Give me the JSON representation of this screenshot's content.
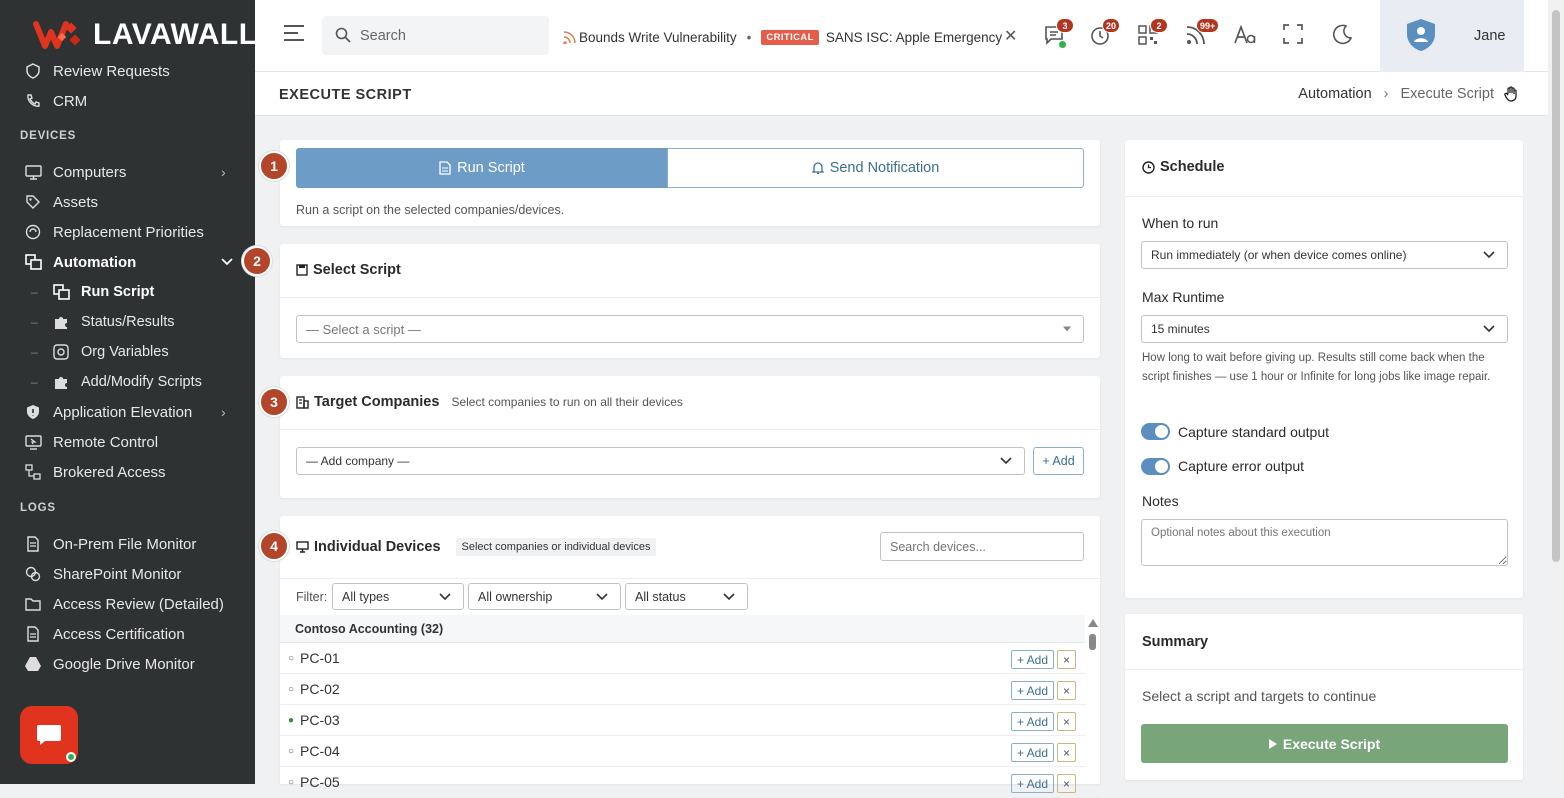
{
  "brand": {
    "name": "LAVAWALL",
    "mark": "®"
  },
  "sidebar": {
    "items": [
      {
        "label": "Review Requests"
      },
      {
        "label": "CRM"
      }
    ],
    "devices_heading": "DEVICES",
    "devices": [
      {
        "label": "Computers"
      },
      {
        "label": "Assets"
      },
      {
        "label": "Replacement Priorities"
      },
      {
        "label": "Automation"
      },
      {
        "label": "Run Script"
      },
      {
        "label": "Status/Results"
      },
      {
        "label": "Org Variables"
      },
      {
        "label": "Add/Modify Scripts"
      },
      {
        "label": "Application Elevation"
      },
      {
        "label": "Remote Control"
      },
      {
        "label": "Brokered Access"
      }
    ],
    "logs_heading": "LOGS",
    "logs": [
      {
        "label": "On-Prem File Monitor"
      },
      {
        "label": "SharePoint Monitor"
      },
      {
        "label": "Access Review (Detailed)"
      },
      {
        "label": "Access Certification"
      },
      {
        "label": "Google Drive Monitor"
      }
    ]
  },
  "topbar": {
    "search_placeholder": "Search",
    "ticker": {
      "item1": "Bounds Write Vulnerability",
      "critical_badge": "CRITICAL",
      "item2": "SANS ISC: Apple Emergency"
    },
    "badges": {
      "messages": "3",
      "alerts": "20",
      "qr": "2",
      "feed": "99+"
    },
    "user_name": "Jane"
  },
  "page": {
    "title": "EXECUTE SCRIPT",
    "breadcrumb": [
      "Automation",
      "Execute Script"
    ]
  },
  "step1": {
    "num": "1",
    "tab_run": "Run Script",
    "tab_notify": "Send Notification",
    "description": "Run a script on the selected companies/devices."
  },
  "step2": {
    "num": "2",
    "title": "Select Script",
    "placeholder": "— Select a script —"
  },
  "step3": {
    "num": "3",
    "title": "Target Companies",
    "hint": "Select companies to run on all their devices",
    "select_value": "— Add company —",
    "add_label": "+ Add"
  },
  "step4": {
    "num": "4",
    "title": "Individual Devices",
    "hint": "Select companies or individual devices",
    "search_placeholder": "Search devices...",
    "filter_label": "Filter:",
    "filters": [
      "All types",
      "All ownership",
      "All status"
    ],
    "group": "Contoso Accounting (32)",
    "add_label": "+ Add",
    "remove_label": "×",
    "devices": [
      {
        "name": "PC-01",
        "status": "○"
      },
      {
        "name": "PC-02",
        "status": "○"
      },
      {
        "name": "PC-03",
        "status": "●"
      },
      {
        "name": "PC-04",
        "status": "○"
      },
      {
        "name": "PC-05",
        "status": "○"
      }
    ]
  },
  "schedule": {
    "title": "Schedule",
    "when_label": "When to run",
    "when_value": "Run immediately (or when device comes online)",
    "max_label": "Max Runtime",
    "max_value": "15 minutes",
    "max_help": "How long to wait before giving up. Results still come back when the script finishes — use 1 hour or Infinite for long jobs like image repair.",
    "capture_stdout": "Capture standard output",
    "capture_stderr": "Capture error output",
    "notes_label": "Notes",
    "notes_placeholder": "Optional notes about this execution"
  },
  "summary": {
    "title": "Summary",
    "text": "Select a script and targets to continue",
    "button": "Execute Script"
  },
  "colors": {
    "sidebar_bg": "#2f3233",
    "accent_blue": "#6d9cc6",
    "step_badge": "#b3462a",
    "execute_green": "#79a57a",
    "brand_red": "#e0341e"
  }
}
